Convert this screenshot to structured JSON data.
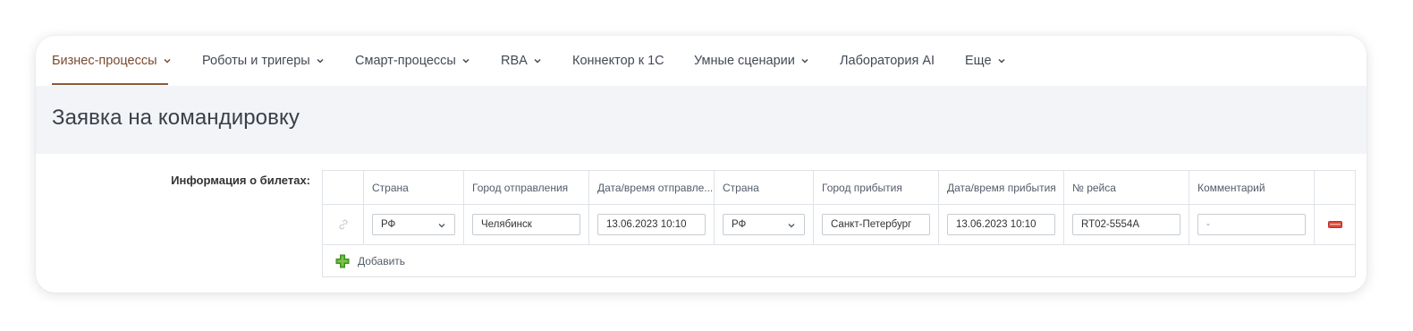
{
  "nav": {
    "items": [
      {
        "label": "Бизнес-процессы",
        "has_menu": true,
        "active": true
      },
      {
        "label": "Роботы и тригеры",
        "has_menu": true
      },
      {
        "label": "Смарт-процессы",
        "has_menu": true
      },
      {
        "label": "RBA",
        "has_menu": true
      },
      {
        "label": "Коннектор к 1С",
        "has_menu": false
      },
      {
        "label": "Умные сценарии",
        "has_menu": true
      },
      {
        "label": "Лаборатория AI",
        "has_menu": false
      },
      {
        "label": "Еще",
        "has_menu": true
      }
    ]
  },
  "page": {
    "title": "Заявка на командировку"
  },
  "form": {
    "label": "Информация о билетах:",
    "columns": [
      "Страна",
      "Город отправления",
      "Дата/время отправле...",
      "Страна",
      "Город прибытия",
      "Дата/время прибытия",
      "№ рейса",
      "Комментарий"
    ],
    "row": {
      "country_from": "РФ",
      "city_from": "Челябинск",
      "datetime_from": "13.06.2023 10:10",
      "country_to": "РФ",
      "city_to": "Санкт-Петербург",
      "datetime_to": "13.06.2023 10:10",
      "flight": "RT02-5554A",
      "comment": "-"
    },
    "add_label": "Добавить"
  },
  "icons": {
    "link": "link-icon",
    "remove": "remove-row-icon",
    "add": "add-plus-icon",
    "chevron": "chevron-down-icon"
  },
  "colors": {
    "active_nav": "#7a4a2e",
    "remove": "#e0453a",
    "add": "#5ab031"
  }
}
